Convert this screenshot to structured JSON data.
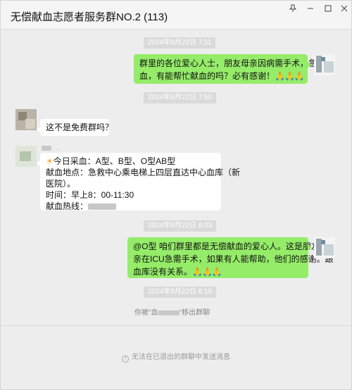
{
  "window": {
    "title": "无偿献血志愿者服务群NO.2 (113)",
    "controls": [
      "pin-icon",
      "minimize-icon",
      "maximize-icon",
      "close-icon"
    ]
  },
  "messages": {
    "t1": "2024年8月22日 7:11",
    "m1_line1": "群里的各位爱心人士，朋友母亲因病需手术，急需用",
    "m1_line2": "血，有能帮忙献血的吗？必有感谢！",
    "m1_emoji": "🙏🙏🙏",
    "t2": "2024年8月22日 7:50",
    "m2": "这不是免费群吗？",
    "m3_sender": "…",
    "m3_line1": "今日采血：A型、B型、O型AB型",
    "m3_line2": "献血地点：急救中心乘电梯上四层直达中心血库（新",
    "m3_line3": "医院）。",
    "m3_line4": "时间：早上8：00-11:30",
    "m3_line5": "献血热线：",
    "t3": "2024年8月22日 8:03",
    "m4_line1": "@O型 咱们群里都是无偿献血的爱心人。这是朋友母",
    "m4_line2": "亲在ICU急需手术，如果有人能帮助，他们的感谢。跟",
    "m4_line3": "血库没有关系。",
    "m4_emoji": "🙏🙏🙏",
    "t4": "2024年8月22日 8:10",
    "sys_prefix": "你被\"血",
    "sys_suffix": "\"移出群聊"
  },
  "footer": {
    "note": "无法在已退出的群聊中发送消息"
  },
  "colors": {
    "own_bubble": "#95ec69",
    "other_bubble": "#ffffff",
    "background": "#ededed"
  }
}
